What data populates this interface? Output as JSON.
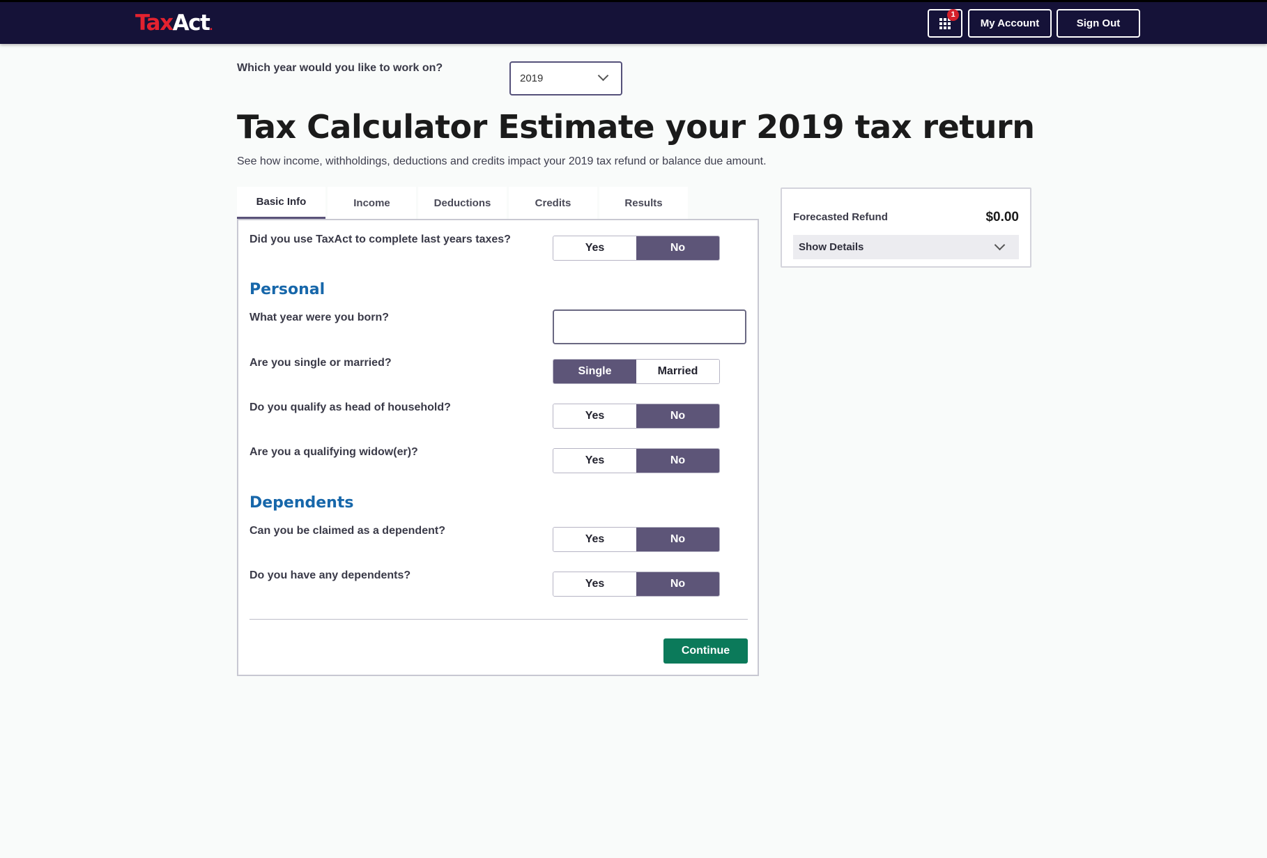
{
  "header": {
    "logo_tax": "Tax",
    "logo_act": "Act",
    "logo_mark": ".",
    "apps_badge": "1",
    "my_account": "My Account",
    "sign_out": "Sign Out"
  },
  "year_picker": {
    "question": "Which year would you like to work on?",
    "selected": "2019"
  },
  "page": {
    "title": "Tax Calculator Estimate your 2019 tax return",
    "subtitle": "See how income, withholdings, deductions and credits impact your 2019 tax refund or balance due amount."
  },
  "tabs": [
    {
      "label": "Basic Info",
      "active": true
    },
    {
      "label": "Income",
      "active": false
    },
    {
      "label": "Deductions",
      "active": false
    },
    {
      "label": "Credits",
      "active": false
    },
    {
      "label": "Results",
      "active": false
    }
  ],
  "form": {
    "used_taxact": {
      "question": "Did you use TaxAct to complete last years taxes?",
      "options": [
        "Yes",
        "No"
      ],
      "selected": "No"
    },
    "personal_heading": "Personal",
    "birth_year": {
      "question": "What year were you born?",
      "value": ""
    },
    "marital": {
      "question": "Are you single or married?",
      "options": [
        "Single",
        "Married"
      ],
      "selected": "Single"
    },
    "head_household": {
      "question": "Do you qualify as head of household?",
      "options": [
        "Yes",
        "No"
      ],
      "selected": "No"
    },
    "widow": {
      "question": "Are you a qualifying widow(er)?",
      "options": [
        "Yes",
        "No"
      ],
      "selected": "No"
    },
    "dependents_heading": "Dependents",
    "claimed_dependent": {
      "question": "Can you be claimed as a dependent?",
      "options": [
        "Yes",
        "No"
      ],
      "selected": "No"
    },
    "have_dependents": {
      "question": "Do you have any dependents?",
      "options": [
        "Yes",
        "No"
      ],
      "selected": "No"
    },
    "continue": "Continue"
  },
  "refund": {
    "label": "Forecasted Refund",
    "amount": "$0.00",
    "show_details": "Show Details"
  },
  "colors": {
    "nav_bg": "#151238",
    "logo_red": "#e3222f",
    "toggle_selected": "#5d5578",
    "section_heading": "#1767aa",
    "continue_green": "#0b7a5a"
  }
}
